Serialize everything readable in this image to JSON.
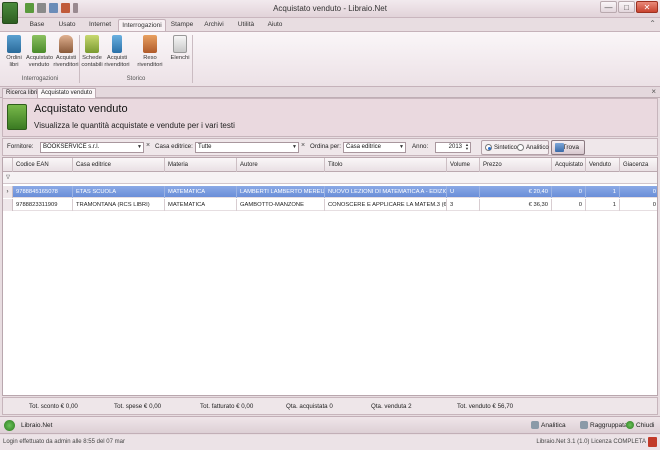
{
  "window": {
    "title": "Acquistato venduto - Libraio.Net",
    "minimize": "—",
    "maximize": "□",
    "close": "✕"
  },
  "ribbon_tabs": [
    "Base",
    "Usato",
    "Internet",
    "Interrogazioni",
    "Stampe",
    "Archivi",
    "Utilità",
    "Aiuto"
  ],
  "active_ribbon_tab": "Interrogazioni",
  "ribbon": {
    "groups": [
      {
        "label": "Interrogazioni",
        "buttons": [
          {
            "line1": "Ordini",
            "line2": "libri",
            "icon": "books-icon"
          },
          {
            "line1": "Acquistato",
            "line2": "venduto",
            "icon": "books-cart-icon"
          },
          {
            "line1": "Acquisti",
            "line2": "rivenditori",
            "icon": "person-icon"
          }
        ]
      },
      {
        "label": "Storico",
        "buttons": [
          {
            "line1": "Schede",
            "line2": "contabili",
            "icon": "ledger-icon"
          },
          {
            "line1": "Acquisti",
            "line2": "rivenditori",
            "icon": "bottle-icon"
          },
          {
            "line1": "Reso rivenditori",
            "line2": "",
            "icon": "return-icon"
          },
          {
            "line1": "Elenchi",
            "line2": "",
            "icon": "list-icon"
          }
        ]
      }
    ]
  },
  "doc_tabs": [
    "Ricerca libri",
    "Acquistato venduto"
  ],
  "active_doc_tab": "Acquistato venduto",
  "header": {
    "title": "Acquistato venduto",
    "subtitle": "Visualizza le quantità acquistate e vendute per i vari testi"
  },
  "filters": {
    "fornitore_label": "Fornitore:",
    "fornitore_value": "BOOKSERVICE s.r.l.",
    "casa_label": "Casa editrice:",
    "casa_value": "Tutte",
    "ordina_label": "Ordina per:",
    "ordina_value": "Casa editrice",
    "anno_label": "Anno:",
    "anno_value": "2013",
    "radio_sintetico": "Sintetico",
    "radio_analitico": "Analitico",
    "selected_mode": "Sintetico",
    "trova_label": "Trova"
  },
  "grid": {
    "columns": [
      "Codice EAN",
      "Casa editrice",
      "Materia",
      "Autore",
      "Titolo",
      "Volume",
      "Prezzo",
      "Acquistato",
      "Venduto",
      "Giacenza"
    ],
    "filter_icon": "∇",
    "rows": [
      {
        "indicator": "›",
        "ean": "9788845165078",
        "casa": "ETAS SCUOLA",
        "materia": "MATEMATICA",
        "autore": "LAMBERTI LAMBERTO MEREU LA...",
        "titolo": "NUOVO LEZIONI DI  MATEMATICA  A - EDIZION...",
        "volume": "U",
        "prezzo": "€ 20,40",
        "acquistato": "0",
        "venduto": "1",
        "giacenza": "0",
        "selected": true
      },
      {
        "indicator": "",
        "ean": "9788823311909",
        "casa": "TRAMONTANA (RCS LIBRI)",
        "materia": "MATEMATICA",
        "autore": "GAMBOTTO-MANZONE",
        "titolo": "CONOSCERE E APPLICARE LA MATEM.3 (604)",
        "volume": "3",
        "prezzo": "€ 36,30",
        "acquistato": "0",
        "venduto": "1",
        "giacenza": "0",
        "selected": false
      }
    ]
  },
  "summary": {
    "sconto": "Tot. sconto € 0,00",
    "spese": "Tot. spese € 0,00",
    "fatturato": "Tot. fatturato € 0,00",
    "qta_acquistata": "Qta. acquistata 0",
    "qta_venduta": "Qta. venduta 2",
    "tot_venduto": "Tot. venduto € 56,70"
  },
  "bottombar": {
    "label": "Libraio.Net",
    "analitica": "Analitica",
    "raggruppata": "Raggruppata",
    "chiudi": "Chiudi"
  },
  "statusbar": {
    "left": "Login effettuato da admin alle 8:55 del 07 mar",
    "right": "Libraio.Net 3.1 (1.0) Licenza COMPLETA"
  },
  "colors": {
    "selection": "#6a8ed8",
    "chrome": "#e8dde1",
    "accent_green": "#3a7a22"
  }
}
